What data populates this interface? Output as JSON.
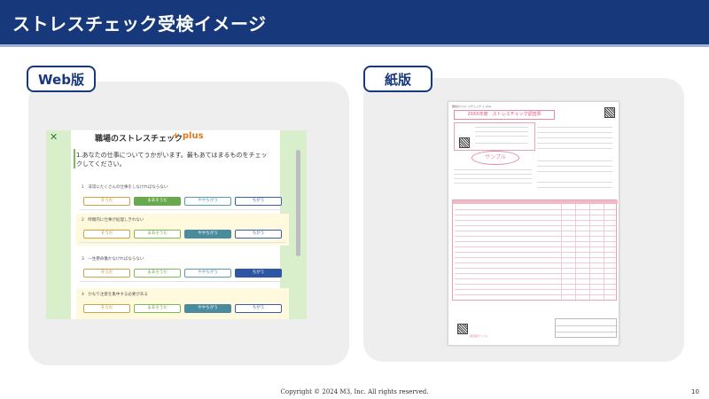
{
  "header": {
    "title": "ストレスチェック受検イメージ"
  },
  "sections": {
    "web_label": "Web版",
    "paper_label": "紙版"
  },
  "web_screen": {
    "brand": "職場のストレスチェック",
    "brand_plus": "+ plus",
    "question": "1.あなたの仕事についてうかがいます。最もあてはまるものをチェックしてください。",
    "options": [
      "そうだ",
      "まあそうだ",
      "ややちがう",
      "ちがう"
    ],
    "items": [
      {
        "text": "1　非常にたくさんの仕事をしなければならない",
        "selected": 2
      },
      {
        "text": "2　時間内に仕事が処理しきれない",
        "selected": 3
      },
      {
        "text": "3　一生懸命働かなければならない",
        "selected": 4
      },
      {
        "text": "4　かなり注意を集中する必要がある",
        "selected": 3
      }
    ]
  },
  "paper_sheet": {
    "header_small": "職場のストレスチェック ＋ plus",
    "title": "20XX年度　ストレスチェック調査票",
    "stamp": "サンプル",
    "footer": "調査票サンプル"
  },
  "footer": {
    "copyright": "Copyright © 2024  M3, Inc.  All rights reserved.",
    "page_number": "10"
  },
  "colors": {
    "header": "#17387a",
    "panel": "#eeeeee",
    "accent_green": "#6aa84f",
    "accent_teal": "#4b8ba0",
    "accent_blue": "#2f55a5",
    "paper_pink": "#e28ba1"
  }
}
